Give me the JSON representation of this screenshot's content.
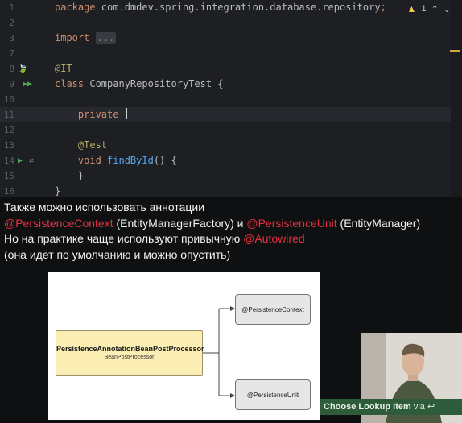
{
  "editor": {
    "inspections": {
      "warning_count": "1"
    },
    "lines": [
      {
        "num": "1",
        "segments": [
          {
            "t": "package ",
            "c": "kw"
          },
          {
            "t": "com.dmdev.spring.integration.database.repository",
            "c": ""
          },
          {
            "t": ";",
            "c": "kw"
          }
        ]
      },
      {
        "num": "2",
        "segments": []
      },
      {
        "num": "3",
        "segments": [
          {
            "t": "import ",
            "c": "kw"
          },
          {
            "t": "...",
            "c": "fold"
          }
        ]
      },
      {
        "num": "7",
        "segments": []
      },
      {
        "num": "8",
        "segments": [
          {
            "t": "@IT",
            "c": "ann"
          }
        ]
      },
      {
        "num": "9",
        "segments": [
          {
            "t": "class ",
            "c": "kw"
          },
          {
            "t": "CompanyRepositoryTest {",
            "c": ""
          }
        ]
      },
      {
        "num": "10",
        "segments": []
      },
      {
        "num": "11",
        "segments": [
          {
            "t": "    private ",
            "c": "kw"
          }
        ],
        "caret": true,
        "current": true
      },
      {
        "num": "12",
        "segments": []
      },
      {
        "num": "13",
        "segments": [
          {
            "t": "    @Test",
            "c": "ann"
          }
        ]
      },
      {
        "num": "14",
        "segments": [
          {
            "t": "    void ",
            "c": "kw"
          },
          {
            "t": "findById",
            "c": "fn"
          },
          {
            "t": "() {",
            "c": ""
          }
        ]
      },
      {
        "num": "15",
        "segments": [
          {
            "t": "    }",
            "c": ""
          }
        ]
      },
      {
        "num": "16",
        "segments": [
          {
            "t": "}",
            "c": ""
          }
        ]
      }
    ]
  },
  "slide": {
    "line1": "Также можно использовать аннотации",
    "line2": {
      "a1": "@PersistenceContext",
      "t1": " (EntityManagerFactory) и ",
      "a2": "@PersistenceUnit",
      "t2": " (EntityManager)"
    },
    "line3": {
      "t": "Но на практике чаще используют привычную ",
      "a": "@Autowired"
    },
    "line4": "(она идет по умолчанию и можно опустить)",
    "diagram": {
      "processor_title": "PersistenceAnnotationBeanPostProcessor",
      "processor_subtitle": "BeanPostProcessor",
      "target_top": "@PersistenceContext",
      "target_bottom": "@PersistenceUnit"
    },
    "colors": {
      "accent_red": "#e4303f",
      "processor_fill": "#fbeeb5"
    }
  },
  "popup": {
    "label_bold": "Choose Lookup Item",
    "label_rest": " via ",
    "shortcut_icon": "enter-key-icon"
  }
}
